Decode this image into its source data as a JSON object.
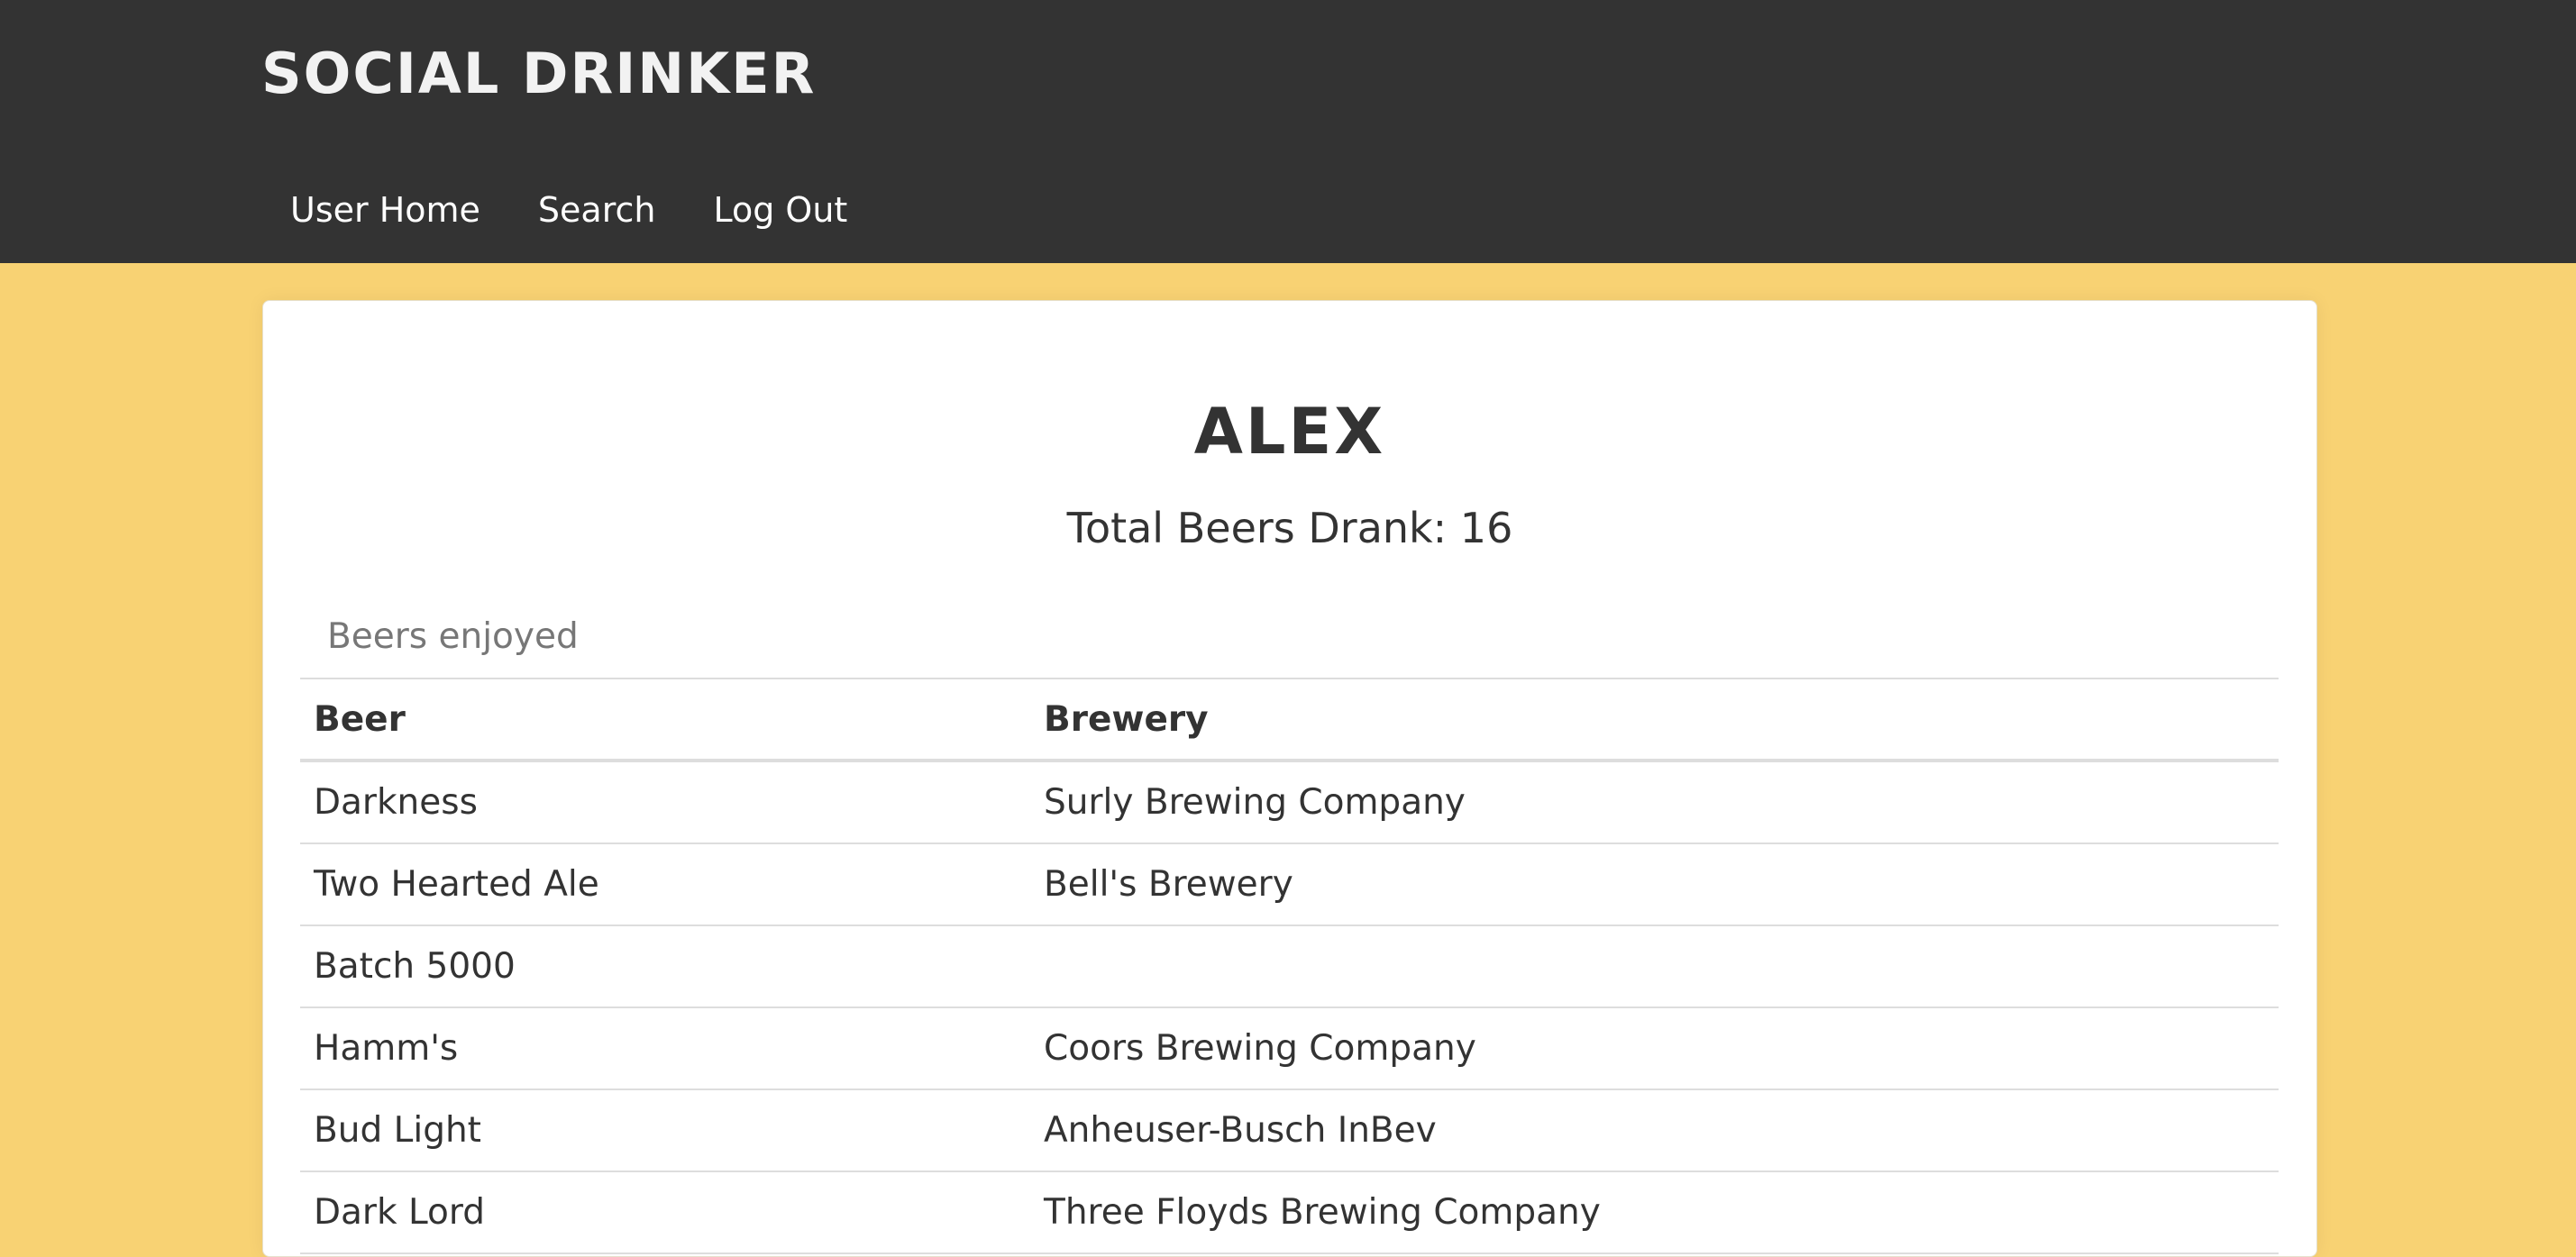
{
  "header": {
    "brand": "Social Drinker",
    "nav": [
      "User Home",
      "Search",
      "Log Out"
    ]
  },
  "profile": {
    "name": "Alex",
    "total": "Total Beers Drank: 16"
  },
  "table": {
    "caption": "Beers enjoyed",
    "columns": [
      "Beer",
      "Brewery"
    ],
    "rows": [
      [
        "Darkness",
        "Surly Brewing Company"
      ],
      [
        "Two Hearted Ale",
        "Bell's Brewery"
      ],
      [
        "Batch 5000",
        ""
      ],
      [
        "Hamm's",
        "Coors Brewing Company"
      ],
      [
        "Bud Light",
        "Anheuser-Busch InBev"
      ],
      [
        "Dark Lord",
        "Three Floyds Brewing Company"
      ]
    ]
  },
  "colors": {
    "header_bg": "#333333",
    "page_bg": "#f8d273",
    "card_bg": "#ffffff"
  }
}
